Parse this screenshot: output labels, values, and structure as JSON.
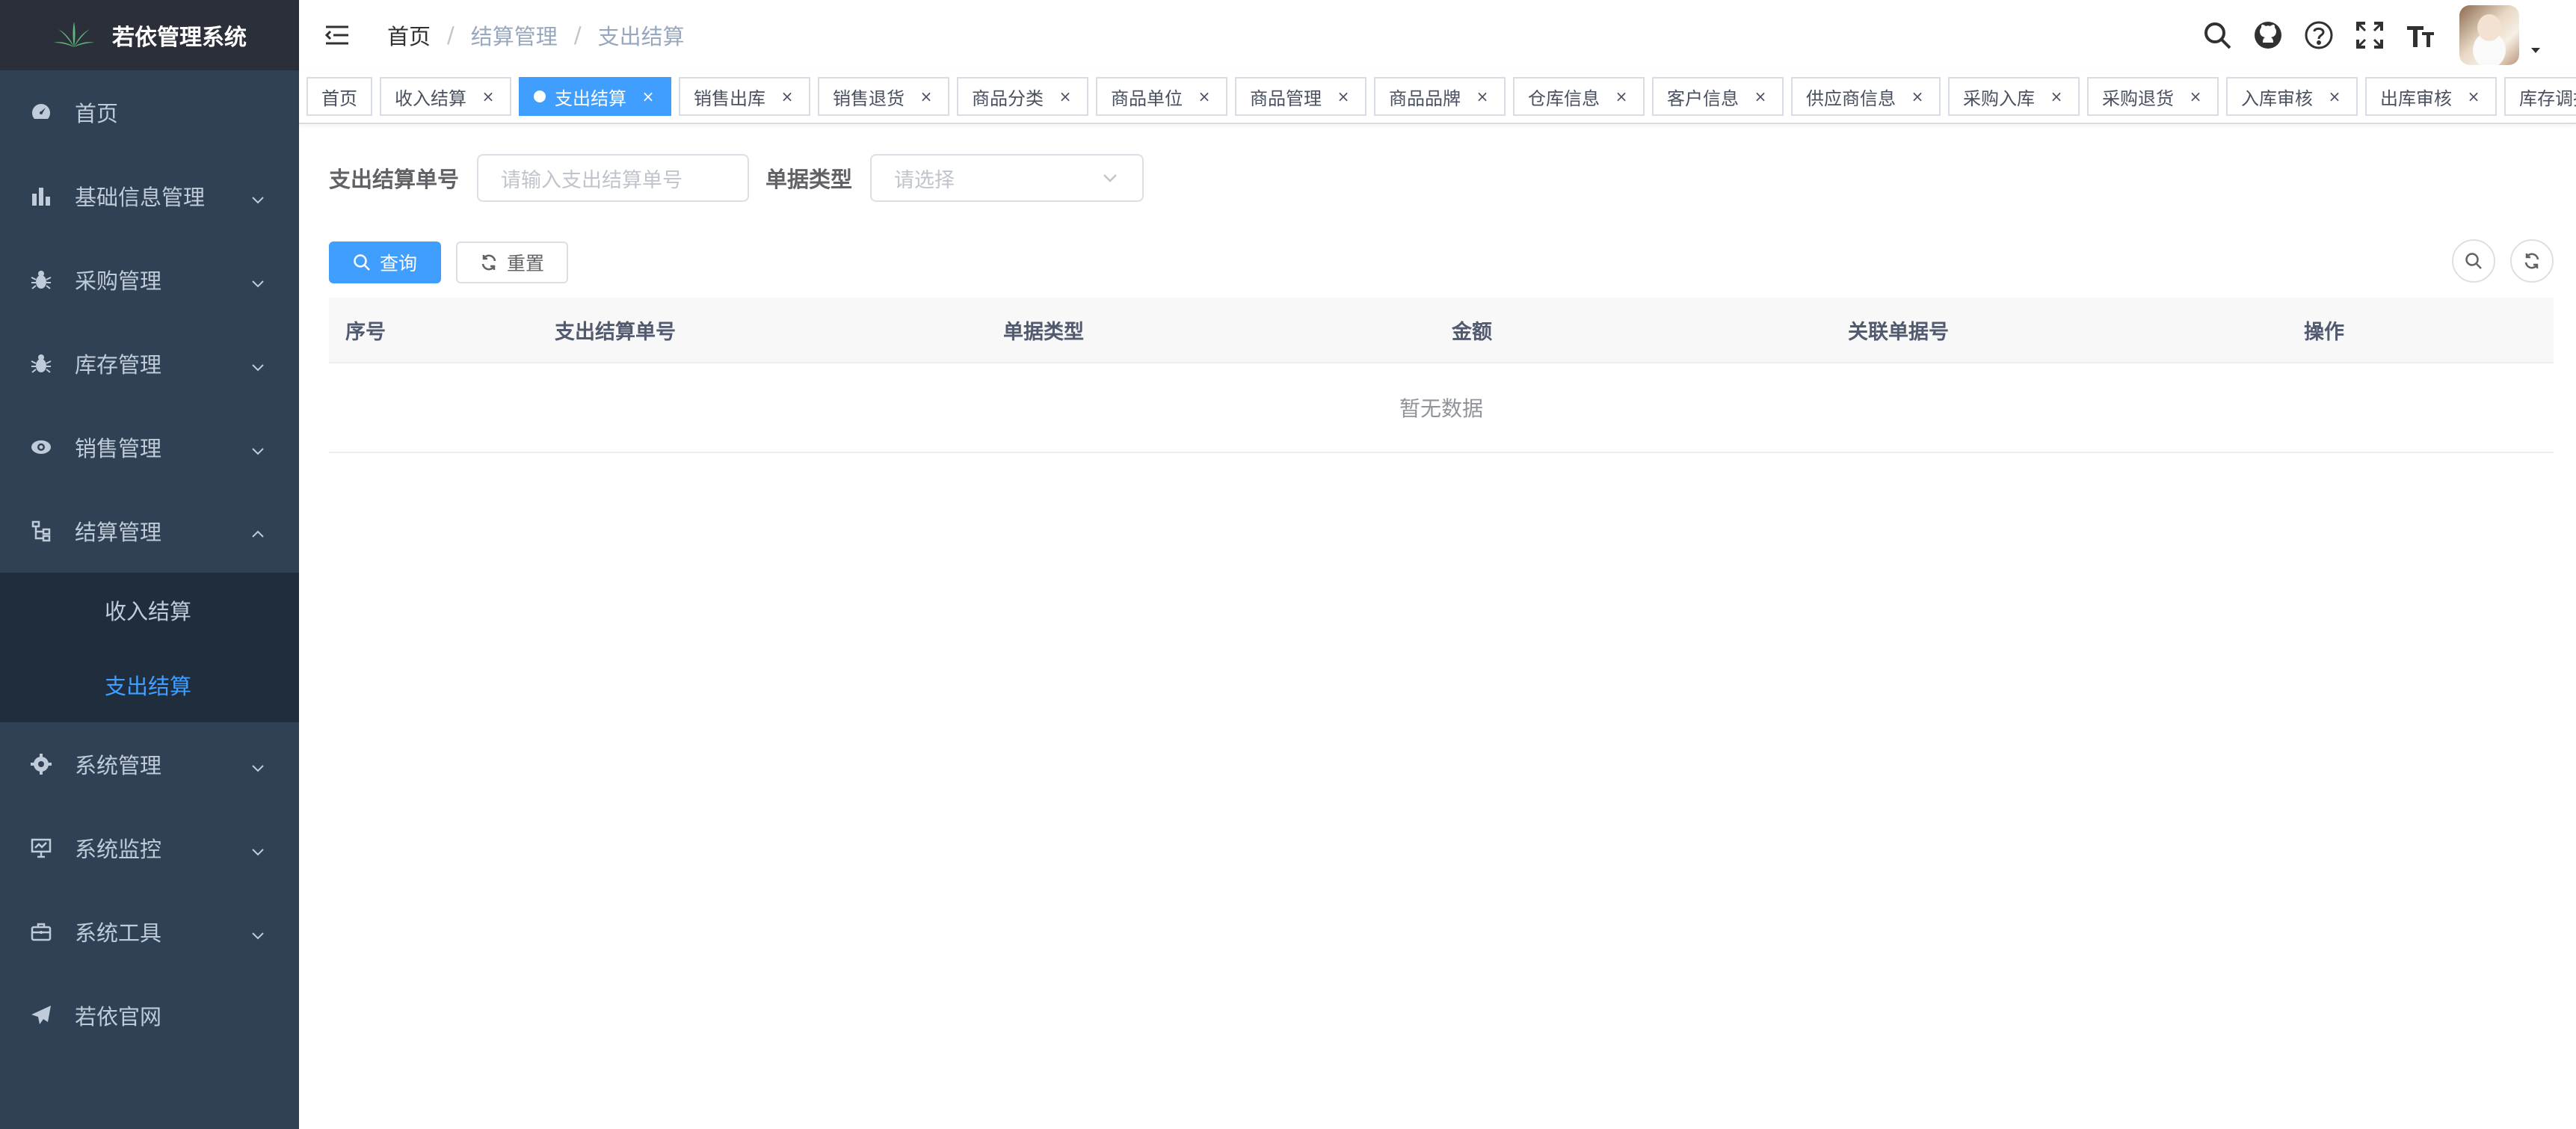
{
  "app": {
    "title": "若依管理系统"
  },
  "sidebar": {
    "items": [
      {
        "label": "首页",
        "icon": "dashboard-icon",
        "has_children": false
      },
      {
        "label": "基础信息管理",
        "icon": "chart-icon",
        "has_children": true
      },
      {
        "label": "采购管理",
        "icon": "bug-icon",
        "has_children": true
      },
      {
        "label": "库存管理",
        "icon": "bug-icon",
        "has_children": true
      },
      {
        "label": "销售管理",
        "icon": "eye-icon",
        "has_children": true
      },
      {
        "label": "结算管理",
        "icon": "tree-icon",
        "has_children": true,
        "expanded": true
      },
      {
        "label": "系统管理",
        "icon": "gear-icon",
        "has_children": true
      },
      {
        "label": "系统监控",
        "icon": "monitor-icon",
        "has_children": true
      },
      {
        "label": "系统工具",
        "icon": "tool-icon",
        "has_children": true
      },
      {
        "label": "若依官网",
        "icon": "guide-icon",
        "has_children": false
      }
    ],
    "submenu": [
      {
        "label": "收入结算",
        "active": false
      },
      {
        "label": "支出结算",
        "active": true
      }
    ]
  },
  "breadcrumb": [
    "首页",
    "结算管理",
    "支出结算"
  ],
  "tags": [
    {
      "label": "首页",
      "active": false,
      "closable": false
    },
    {
      "label": "收入结算",
      "active": false,
      "closable": true
    },
    {
      "label": "支出结算",
      "active": true,
      "closable": true
    },
    {
      "label": "销售出库",
      "active": false,
      "closable": true
    },
    {
      "label": "销售退货",
      "active": false,
      "closable": true
    },
    {
      "label": "商品分类",
      "active": false,
      "closable": true
    },
    {
      "label": "商品单位",
      "active": false,
      "closable": true
    },
    {
      "label": "商品管理",
      "active": false,
      "closable": true
    },
    {
      "label": "商品品牌",
      "active": false,
      "closable": true
    },
    {
      "label": "仓库信息",
      "active": false,
      "closable": true
    },
    {
      "label": "客户信息",
      "active": false,
      "closable": true
    },
    {
      "label": "供应商信息",
      "active": false,
      "closable": true
    },
    {
      "label": "采购入库",
      "active": false,
      "closable": true
    },
    {
      "label": "采购退货",
      "active": false,
      "closable": true
    },
    {
      "label": "入库审核",
      "active": false,
      "closable": true
    },
    {
      "label": "出库审核",
      "active": false,
      "closable": true
    },
    {
      "label": "库存调拨",
      "active": false,
      "closable": true
    }
  ],
  "tag_close_symbol": "×",
  "form": {
    "settlement_no_label": "支出结算单号",
    "settlement_no_placeholder": "请输入支出结算单号",
    "doc_type_label": "单据类型",
    "doc_type_placeholder": "请选择"
  },
  "toolbar": {
    "query_label": "查询",
    "reset_label": "重置"
  },
  "table": {
    "columns": [
      "序号",
      "支出结算单号",
      "单据类型",
      "金额",
      "关联单据号",
      "操作"
    ],
    "empty_text": "暂无数据"
  },
  "colors": {
    "sidebar_bg": "#304156",
    "submenu_bg": "#1f2d3d",
    "accent": "#409eff",
    "menu_text": "#bfcbd9"
  }
}
